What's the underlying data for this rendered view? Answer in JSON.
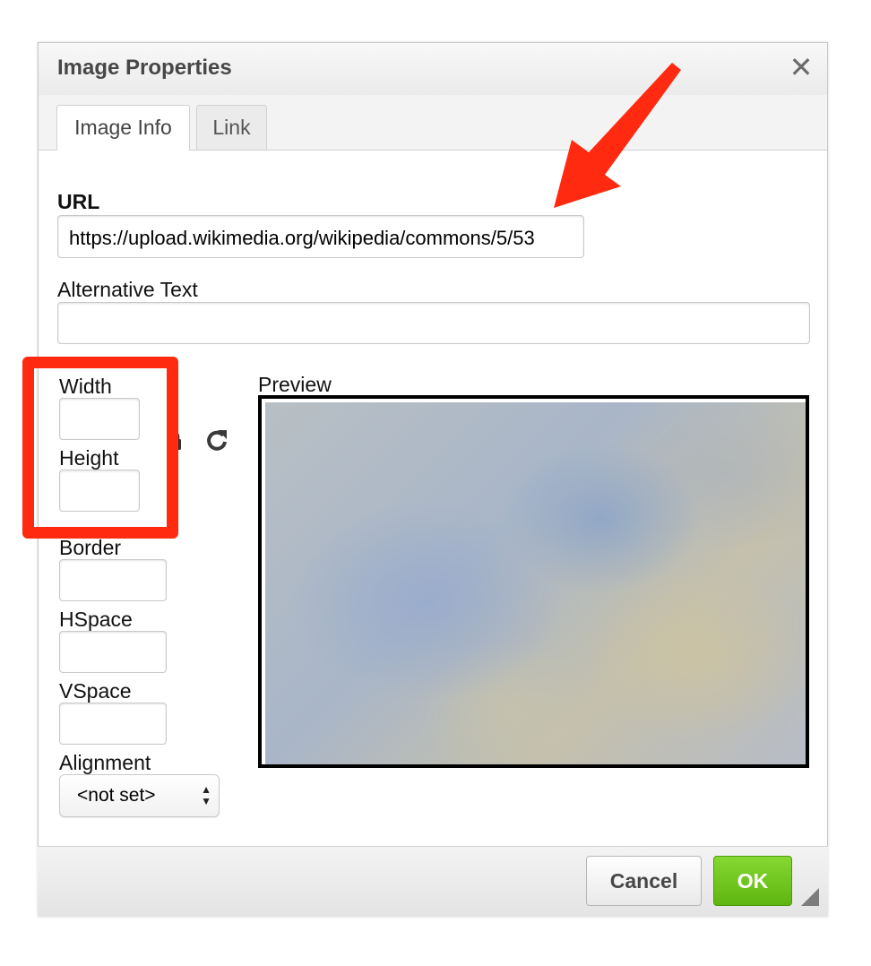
{
  "dialog": {
    "title": "Image Properties",
    "close_glyph": "✕"
  },
  "tabs": [
    {
      "label": "Image Info",
      "active": true
    },
    {
      "label": "Link",
      "active": false
    }
  ],
  "form": {
    "url_label": "URL",
    "url_value": "https://upload.wikimedia.org/wikipedia/commons/5/53",
    "alt_label": "Alternative Text",
    "alt_value": "",
    "width_label": "Width",
    "width_value": "",
    "height_label": "Height",
    "height_value": "",
    "border_label": "Border",
    "border_value": "",
    "hspace_label": "HSpace",
    "hspace_value": "",
    "vspace_label": "VSpace",
    "vspace_value": "",
    "alignment_label": "Alignment",
    "alignment_value": "<not set>",
    "preview_label": "Preview"
  },
  "buttons": {
    "cancel": "Cancel",
    "ok": "OK"
  },
  "icons": {
    "lock": "lock-icon",
    "reset": "reset-size-icon",
    "close": "close-icon",
    "resize": "resize-handle-icon"
  },
  "annotation": {
    "highlight_color": "#ff2a0f",
    "arrow_color": "#ff2a0f"
  },
  "colors": {
    "ok_button": "#6cc31d"
  }
}
